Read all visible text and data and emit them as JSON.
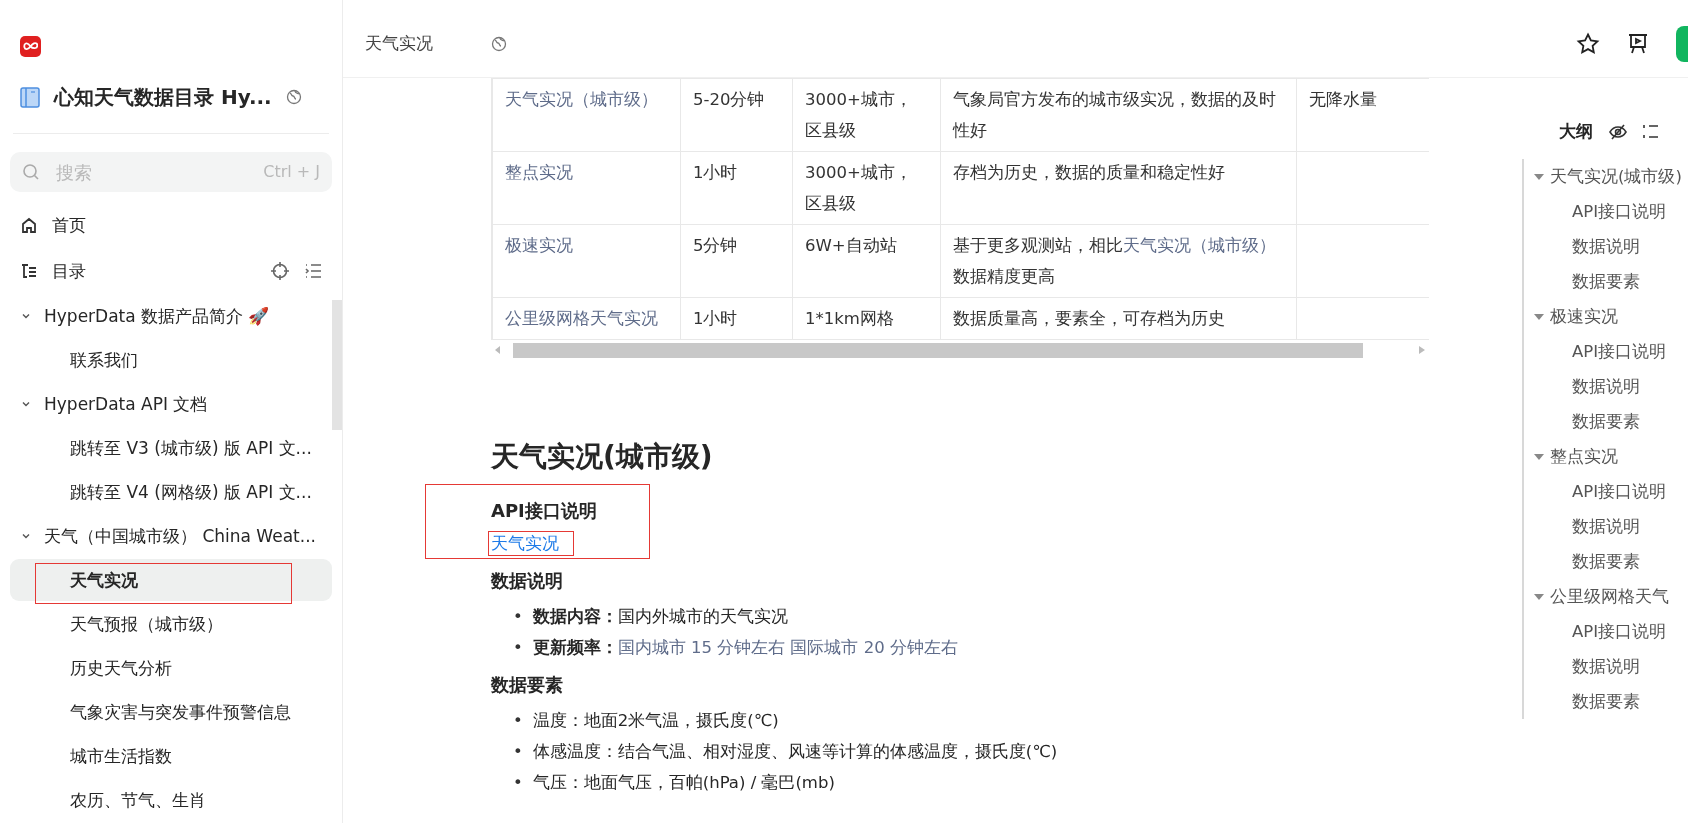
{
  "sidebar": {
    "doc_title": "心知天气数据目录 Hy...",
    "search": {
      "placeholder": "搜索",
      "shortcut": "Ctrl + J"
    },
    "nav": [
      {
        "kind": "home",
        "label": "首页"
      },
      {
        "kind": "toc",
        "label": "目录"
      }
    ],
    "tree": [
      {
        "label": "HyperData 数据产品简介 🚀",
        "expanded": true,
        "selected": false,
        "children": [
          {
            "label": "联系我们",
            "selected": false
          }
        ]
      },
      {
        "label": "HyperData API 文档",
        "expanded": true,
        "selected": false,
        "children": [
          {
            "label": "跳转至 V3 (城市级) 版 API 文...",
            "selected": false
          },
          {
            "label": "跳转至 V4 (网格级) 版 API 文...",
            "selected": false
          }
        ]
      },
      {
        "label": "天气（中国城市级） China Weat...",
        "expanded": true,
        "selected": false,
        "children": [
          {
            "label": "天气实况",
            "selected": true
          },
          {
            "label": "天气预报（城市级）",
            "selected": false
          },
          {
            "label": "历史天气分析",
            "selected": false
          },
          {
            "label": "气象灾害与突发事件预警信息",
            "selected": false
          },
          {
            "label": "城市生活指数",
            "selected": false
          },
          {
            "label": "农历、节气、生肖",
            "selected": false
          }
        ]
      }
    ]
  },
  "header": {
    "title": "天气实况"
  },
  "table": {
    "rows": [
      [
        {
          "parts": [
            {
              "text": "天气实况（城市级）",
              "link": true
            }
          ]
        },
        {
          "parts": [
            {
              "text": "5-20分钟",
              "link": false
            }
          ]
        },
        {
          "parts": [
            {
              "text": "3000+城市，区县级",
              "link": false
            }
          ]
        },
        {
          "parts": [
            {
              "text": "气象局官方发布的城市级实况，数据的及时性好",
              "link": false
            }
          ]
        },
        {
          "parts": [
            {
              "text": "无降水量",
              "link": false
            }
          ]
        }
      ],
      [
        {
          "parts": [
            {
              "text": "整点实况",
              "link": true
            }
          ]
        },
        {
          "parts": [
            {
              "text": "1小时",
              "link": false
            }
          ]
        },
        {
          "parts": [
            {
              "text": "3000+城市，区县级",
              "link": false
            }
          ]
        },
        {
          "parts": [
            {
              "text": "存档为历史，数据的质量和稳定性好",
              "link": false
            }
          ]
        },
        {}
      ],
      [
        {
          "parts": [
            {
              "text": "极速实况",
              "link": true
            }
          ]
        },
        {
          "parts": [
            {
              "text": "5分钟",
              "link": false
            }
          ]
        },
        {
          "parts": [
            {
              "text": "6W+自动站",
              "link": false
            }
          ]
        },
        {
          "parts": [
            {
              "text": "基于更多观测站，相比",
              "link": false
            },
            {
              "text": "天气实况（城市级）",
              "link": true
            },
            {
              "text": "数据精度更高",
              "link": false
            }
          ]
        },
        {}
      ],
      [
        {
          "parts": [
            {
              "text": "公里级网格天气实况",
              "link": true
            }
          ]
        },
        {
          "parts": [
            {
              "text": "1小时",
              "link": false
            }
          ]
        },
        {
          "parts": [
            {
              "text": "1*1km网格",
              "link": false
            }
          ]
        },
        {
          "parts": [
            {
              "text": "数据质量高，要素全，可存档为历史",
              "link": false
            }
          ]
        },
        {}
      ]
    ]
  },
  "article": {
    "heading": "天气实况(城市级)",
    "sections": [
      {
        "title": "API接口说明",
        "link": "天气实况"
      },
      {
        "title": "数据说明",
        "bullets": [
          {
            "marker": "•",
            "label": "数据内容：",
            "text": "国内外城市的天气实况",
            "link": false
          },
          {
            "marker": "•",
            "label": "更新频率：",
            "text": "国内城市 15 分钟左右 国际城市 20 分钟左右",
            "link": true
          }
        ]
      },
      {
        "title": "数据要素",
        "bullets": [
          {
            "marker": "•",
            "text": "温度：地面2米气温，摄氏度(℃)",
            "link": false
          },
          {
            "marker": "•",
            "text": "体感温度：结合气温、相对湿度、风速等计算的体感温度，摄氏度(℃)",
            "link": false
          },
          {
            "marker": "•",
            "text": "气压：地面气压，百帕(hPa) / 毫巴(mb)",
            "link": false
          }
        ]
      }
    ]
  },
  "outline": {
    "title": "大纲",
    "items": [
      {
        "label": "天气实况(城市级)",
        "expanded": true,
        "children": [
          "API接口说明",
          "数据说明",
          "数据要素"
        ]
      },
      {
        "label": "极速实况",
        "expanded": true,
        "children": [
          "API接口说明",
          "数据说明",
          "数据要素"
        ]
      },
      {
        "label": "整点实况",
        "expanded": true,
        "children": [
          "API接口说明",
          "数据说明",
          "数据要素"
        ]
      },
      {
        "label": "公里级网格天气",
        "expanded": true,
        "children": [
          "API接口说明",
          "数据说明",
          "数据要素"
        ]
      }
    ]
  }
}
